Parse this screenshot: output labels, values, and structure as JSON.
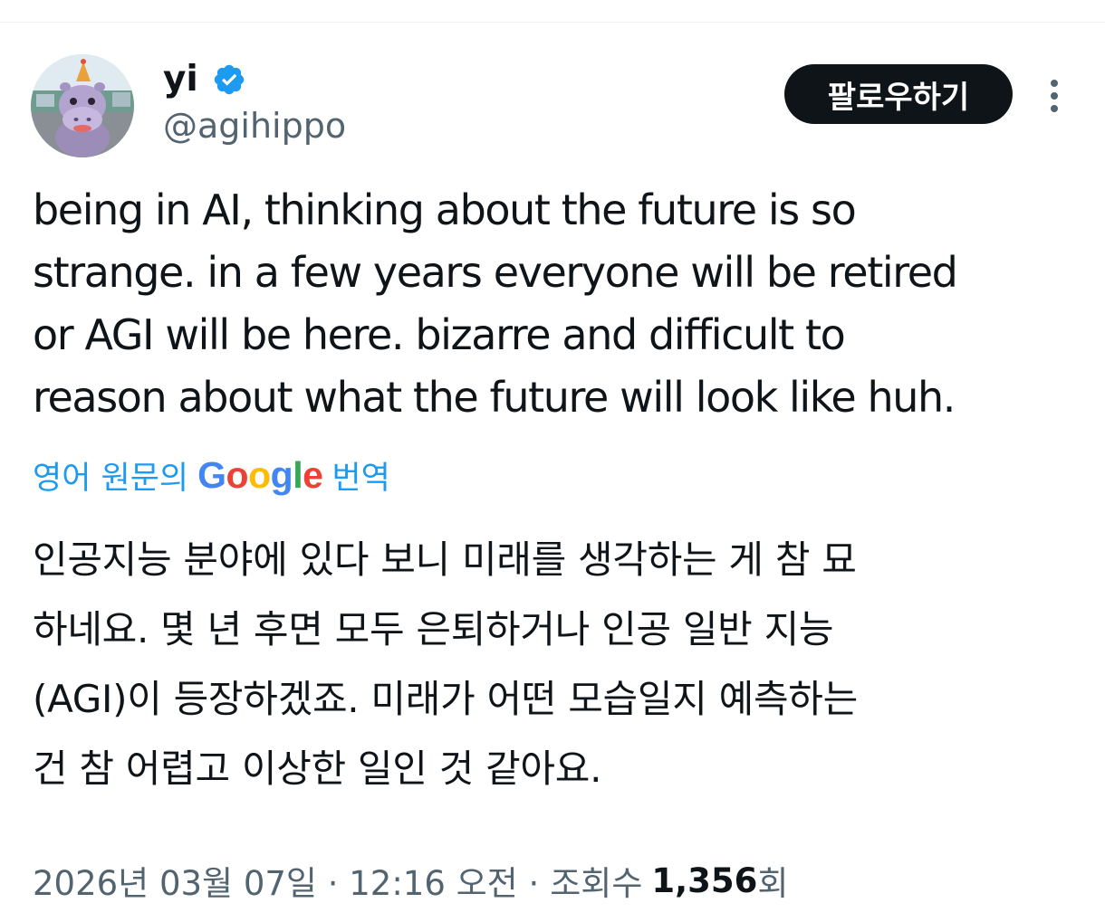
{
  "author": {
    "display_name": "yi",
    "handle": "@agihippo",
    "verified": true
  },
  "follow_button": {
    "label": "팔로우하기"
  },
  "icons": {
    "avatar": "hippo-avatar",
    "verified": "verified-badge-icon",
    "more": "more-vertical-icon"
  },
  "colors": {
    "link_blue": "#1d9bf0",
    "verified_blue": "#1d9bf0",
    "secondary_text": "#536471",
    "follow_bg": "#0f1419"
  },
  "tweet": {
    "text": "being in AI, thinking about the future is so\nstrange. in a few years everyone will be retired\nor AGI will be here. bizarre and difficult to\nreason about what the future will look like huh.",
    "translation_prefix": "영어 원문의",
    "translation_brand": "Google",
    "translation_suffix": "번역",
    "translated_text": "인공지능 분야에 있다 보니 미래를 생각하는 게 참 묘\n하네요. 몇 년 후면 모두 은퇴하거나 인공 일반 지능\n(AGI)이 등장하겠죠. 미래가 어떤 모습일지 예측하는\n건 참 어렵고 이상한 일인 것 같아요."
  },
  "meta": {
    "timestamp": "2026년 03월 07일 · 12:16 오전 ·",
    "views_label": "조회수",
    "views_count": "1,356",
    "views_suffix": "회"
  }
}
